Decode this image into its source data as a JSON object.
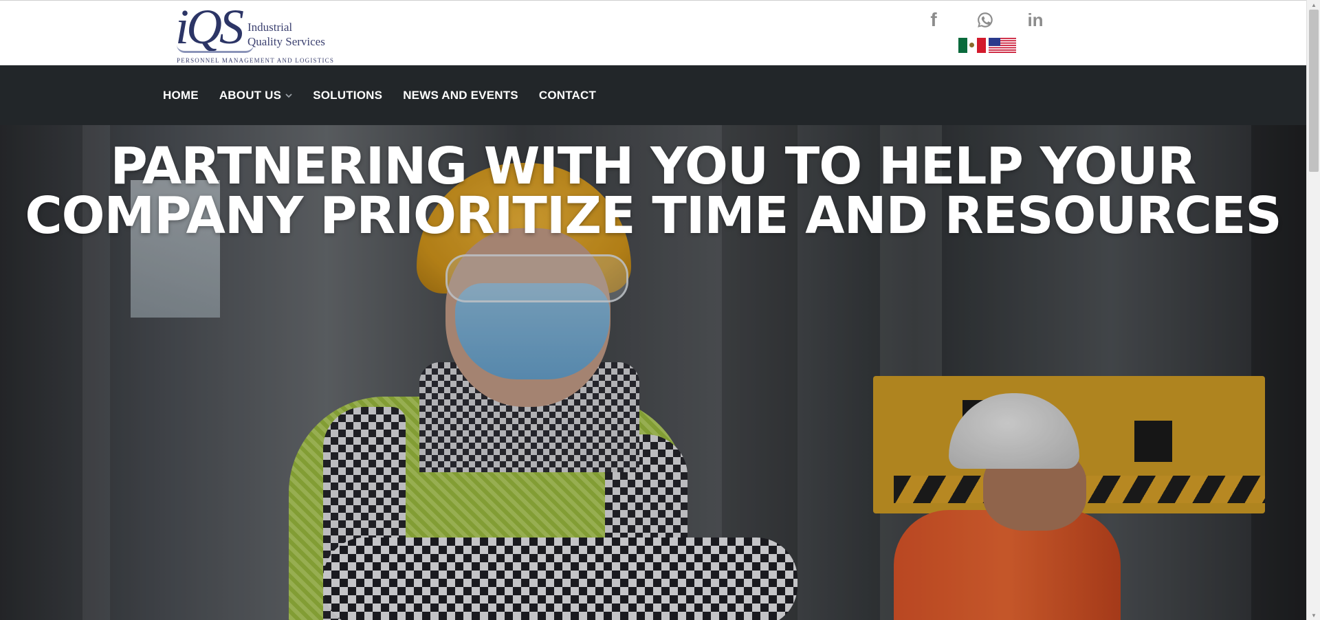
{
  "brand": {
    "logo_mark": "iQS",
    "name_line1": "Industrial",
    "name_line2": "Quality Services",
    "tagline": "PERSONNEL MANAGEMENT AND LOGISTICS"
  },
  "social": [
    {
      "name": "facebook",
      "glyph": "f"
    },
    {
      "name": "whatsapp"
    },
    {
      "name": "linkedin",
      "glyph": "in"
    }
  ],
  "languages": [
    {
      "code": "es-MX",
      "icon": "mexico-flag-icon"
    },
    {
      "code": "en-US",
      "icon": "usa-flag-icon"
    }
  ],
  "nav": {
    "items": [
      {
        "label": "HOME"
      },
      {
        "label": "ABOUT US",
        "has_dropdown": true
      },
      {
        "label": "SOLUTIONS"
      },
      {
        "label": "NEWS AND EVENTS"
      },
      {
        "label": "CONTACT"
      }
    ]
  },
  "hero": {
    "title_line1": "PARTNERING WITH YOU TO HELP YOUR",
    "title_line2": "COMPANY PRIORITIZE TIME AND RESOURCES"
  },
  "colors": {
    "navbar_bg": "#222629",
    "logo_navy": "#2c3566",
    "social_gray": "#8c8c8c",
    "hero_text": "#ffffff"
  }
}
